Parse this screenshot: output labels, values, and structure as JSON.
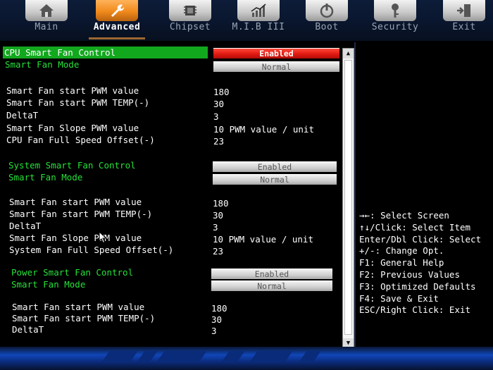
{
  "tabs": [
    {
      "label": "Main",
      "icon": "home-icon"
    },
    {
      "label": "Advanced",
      "icon": "wrench-icon"
    },
    {
      "label": "Chipset",
      "icon": "chip-icon"
    },
    {
      "label": "M.I.B III",
      "icon": "bar-chart-icon"
    },
    {
      "label": "Boot",
      "icon": "power-icon"
    },
    {
      "label": "Security",
      "icon": "key-icon"
    },
    {
      "label": "Exit",
      "icon": "exit-door-icon"
    }
  ],
  "active_tab": "Advanced",
  "cpu": {
    "control_label": "CPU Smart Fan Control",
    "control_value": "Enabled",
    "mode_label": "Smart Fan Mode",
    "mode_value": "Normal",
    "pwm_value_label": "Smart Fan start PWM value",
    "pwm_value": "180",
    "pwm_temp_label": "Smart Fan start PWM TEMP(-)",
    "pwm_temp": "30",
    "delta_label": "DeltaT",
    "delta": "3",
    "slope_label": "Smart Fan Slope PWM value",
    "slope": "10 PWM value / unit",
    "offset_label": "CPU Fan Full Speed Offset(-)",
    "offset": "23"
  },
  "system": {
    "control_label": "System Smart Fan Control",
    "control_value": "Enabled",
    "mode_label": "Smart Fan Mode",
    "mode_value": "Normal",
    "pwm_value_label": "Smart Fan start PWM value",
    "pwm_value": "180",
    "pwm_temp_label": "Smart Fan start PWM TEMP(-)",
    "pwm_temp": "30",
    "delta_label": "DeltaT",
    "delta": "3",
    "slope_label": "Smart Fan Slope PWM value",
    "slope": "10 PWM value / unit",
    "offset_label": "System Fan Full Speed Offset(-)",
    "offset": "23"
  },
  "power": {
    "control_label": "Power Smart Fan Control",
    "control_value": "Enabled",
    "mode_label": "Smart Fan Mode",
    "mode_value": "Normal",
    "pwm_value_label": "Smart Fan start PWM value",
    "pwm_value": "180",
    "pwm_temp_label": "Smart Fan start PWM TEMP(-)",
    "pwm_temp": "30",
    "delta_label": "DeltaT",
    "delta": "3"
  },
  "help": [
    "→←: Select Screen",
    "↑↓/Click: Select Item",
    "Enter/Dbl Click: Select",
    "+/-: Change Opt.",
    "F1: General Help",
    "F2: Previous Values",
    "F3: Optimized Defaults",
    "F4: Save & Exit",
    "ESC/Right Click: Exit"
  ],
  "colors": {
    "selected_row": "#12a81e",
    "section_header": "#26e03a",
    "enabled_active": "#e01a12",
    "active_tab": "#f08a1c"
  }
}
